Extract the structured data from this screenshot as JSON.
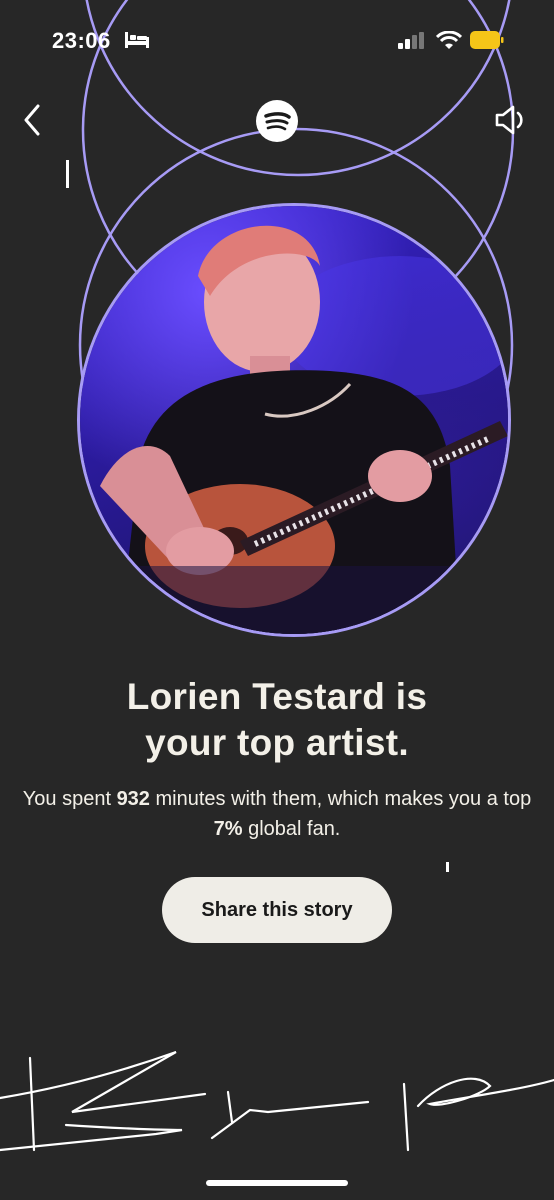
{
  "status_bar": {
    "time": "23:06",
    "icons": [
      "bed-icon",
      "signal-icon",
      "wifi-icon",
      "battery-icon"
    ],
    "battery_color": "#f5c518"
  },
  "nav": {
    "back_icon": "chevron-left-icon",
    "logo_icon": "spotify-logo",
    "sound_icon": "speaker-icon"
  },
  "story": {
    "headline_line1": "Lorien Testard is",
    "headline_line2": "your top artist.",
    "sub_prefix": "You spent ",
    "minutes": "932",
    "sub_middle": " minutes with them, which makes you a top ",
    "percent": "7%",
    "sub_suffix": " global fan.",
    "share_label": "Share this story"
  },
  "colors": {
    "background": "#272727",
    "ring": "#a79bf5",
    "photo_tint": "#3b26d6",
    "button_bg": "#efede7"
  }
}
